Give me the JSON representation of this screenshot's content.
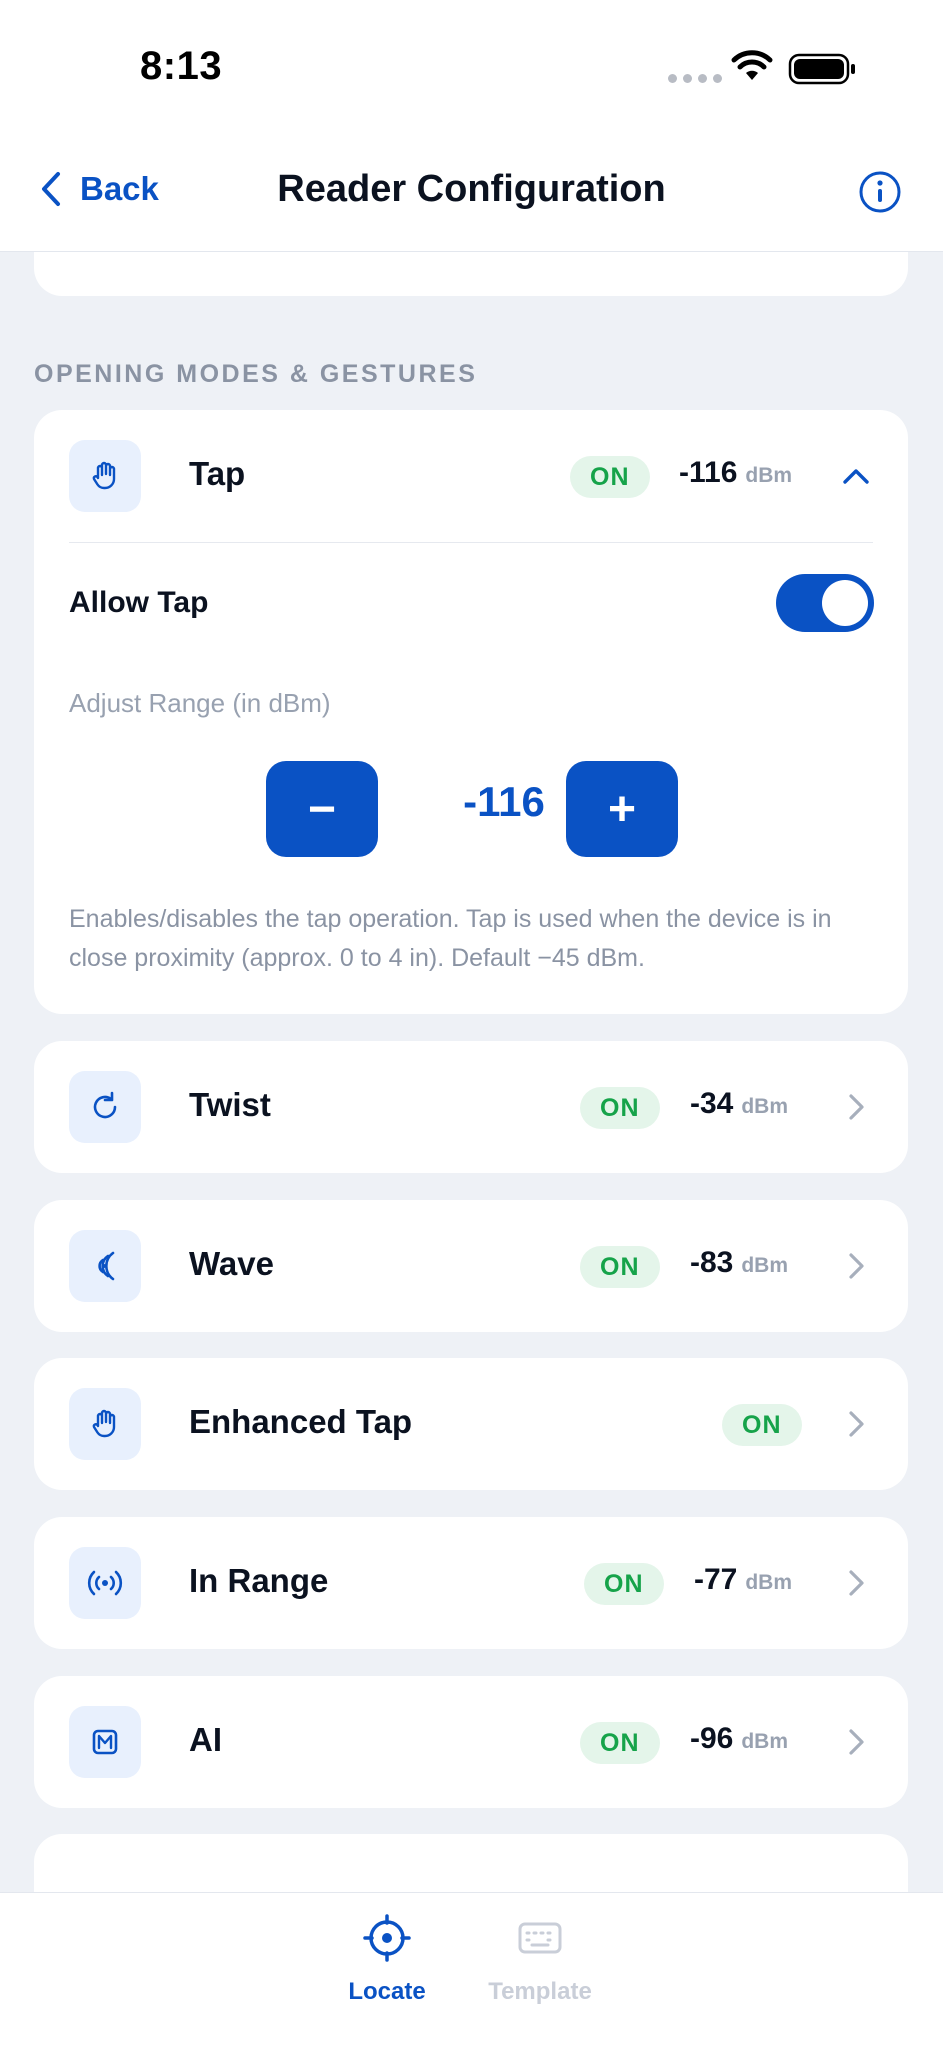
{
  "status_bar": {
    "time": "8:13"
  },
  "header": {
    "back_label": "Back",
    "title": "Reader Configuration"
  },
  "section": {
    "label": "OPENING MODES & GESTURES"
  },
  "tap_card": {
    "title": "Tap",
    "status": "ON",
    "dbm": "-116",
    "unit": "dBm",
    "allow_label": "Allow Tap",
    "allow_enabled": true,
    "range_label": "Adjust Range (in dBm)",
    "minus_label": "−",
    "plus_label": "+",
    "range_value": "-116",
    "help_text": "Enables/disables the tap operation. Tap is used when the device is in close proximity (approx. 0 to 4 in). Default −45 dBm."
  },
  "modes": [
    {
      "title": "Twist",
      "status": "ON",
      "dbm": "-34",
      "unit": "dBm",
      "icon": "rotate-icon"
    },
    {
      "title": "Wave",
      "status": "ON",
      "dbm": "-83",
      "unit": "dBm",
      "icon": "wave-icon"
    },
    {
      "title": "Enhanced Tap",
      "status": "ON",
      "icon": "hand-icon"
    },
    {
      "title": "In Range",
      "status": "ON",
      "dbm": "-77",
      "unit": "dBm",
      "icon": "broadcast-icon"
    },
    {
      "title": "AI",
      "status": "ON",
      "dbm": "-96",
      "unit": "dBm",
      "icon": "m-badge-icon"
    }
  ],
  "tabs": [
    {
      "label": "Locate",
      "active": true,
      "icon": "crosshair-icon"
    },
    {
      "label": "Template",
      "active": false,
      "icon": "keyboard-icon"
    }
  ],
  "colors": {
    "accent": "#0A52C4",
    "on_badge_bg": "#E4F5EA",
    "on_badge_text": "#16A34A",
    "background": "#EEF1F6"
  }
}
